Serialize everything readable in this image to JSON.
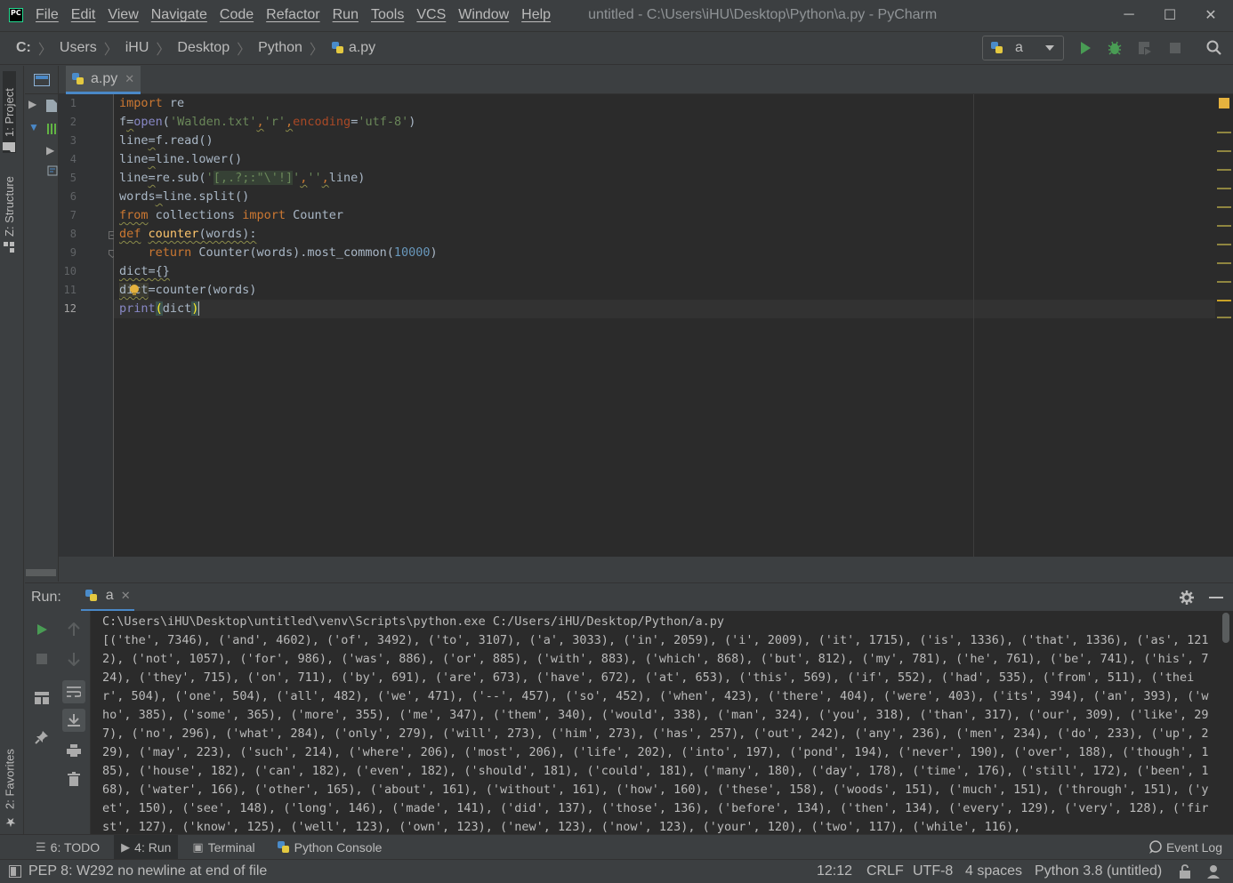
{
  "titlebar": {
    "menu": [
      "File",
      "Edit",
      "View",
      "Navigate",
      "Code",
      "Refactor",
      "Run",
      "Tools",
      "VCS",
      "Window",
      "Help"
    ],
    "window_title": "untitled - C:\\Users\\iHU\\Desktop\\Python\\a.py - PyCharm",
    "controls": {
      "minimize": "─",
      "maximize": "☐",
      "close": "✕"
    }
  },
  "navbar": {
    "crumbs": [
      "C:",
      "Users",
      "iHU",
      "Desktop",
      "Python",
      "a.py"
    ],
    "separator": "〉",
    "run_config": "a"
  },
  "toolbar_icons": [
    "run-icon",
    "debug-icon",
    "coverage-icon",
    "stop-icon",
    "search-icon"
  ],
  "left_stripe": {
    "project_tab": "1: Project",
    "structure_tab": "Z: Structure",
    "favorites_tab": "2: Favorites"
  },
  "editor": {
    "tab_label": "a.py",
    "tab_close": "✕",
    "line_numbers": [
      "1",
      "2",
      "3",
      "4",
      "5",
      "6",
      "7",
      "8",
      "9",
      "10",
      "11",
      "12"
    ],
    "code_lines": [
      "import re",
      "f=open('Walden.txt','r',encoding='utf-8')",
      "line=f.read()",
      "line=line.lower()",
      "line=re.sub('[,.?;:\"\\'!]','',line)",
      "words=line.split()",
      "from collections import Counter",
      "def counter(words):",
      "    return Counter(words).most_common(10000)",
      "dict={}",
      "dict=counter(words)",
      "print(dict)"
    ]
  },
  "run_window": {
    "title": "Run:",
    "tab_label": "a",
    "tab_close": "✕",
    "command": "C:\\Users\\iHU\\Desktop\\untitled\\venv\\Scripts\\python.exe C:/Users/iHU/Desktop/Python/a.py",
    "output": "[('the', 7346), ('and', 4602), ('of', 3492), ('to', 3107), ('a', 3033), ('in', 2059), ('i', 2009), ('it', 1715), ('is', 1336), ('that', 1336), ('as', 1212), ('not', 1057), ('for', 986), ('was', 886), ('or', 885), ('with', 883), ('which', 868), ('but', 812), ('my', 781), ('he', 761), ('be', 741), ('his', 724), ('they', 715), ('on', 711), ('by', 691), ('are', 673), ('have', 672), ('at', 653), ('this', 569), ('if', 552), ('had', 535), ('from', 511), ('their', 504), ('one', 504), ('all', 482), ('we', 471), ('--', 457), ('so', 452), ('when', 423), ('there', 404), ('were', 403), ('its', 394), ('an', 393), ('who', 385), ('some', 365), ('more', 355), ('me', 347), ('them', 340), ('would', 338), ('man', 324), ('you', 318), ('than', 317), ('our', 309), ('like', 297), ('no', 296), ('what', 284), ('only', 279), ('will', 273), ('him', 273), ('has', 257), ('out', 242), ('any', 236), ('men', 234), ('do', 233), ('up', 229), ('may', 223), ('such', 214), ('where', 206), ('most', 206), ('life', 202), ('into', 197), ('pond', 194), ('never', 190), ('over', 188), ('though', 185), ('house', 182), ('can', 182), ('even', 182), ('should', 181), ('could', 181), ('many', 180), ('day', 178), ('time', 176), ('still', 172), ('been', 168), ('water', 166), ('other', 165), ('about', 161), ('without', 161), ('how', 160), ('these', 158), ('woods', 151), ('much', 151), ('through', 151), ('yet', 150), ('see', 148), ('long', 146), ('made', 141), ('did', 137), ('those', 136), ('before', 134), ('then', 134), ('every', 129), ('very', 128), ('first', 127), ('know', 125), ('well', 123), ('own', 123), ('new', 123), ('now', 123), ('your', 120), ('two', 117), ('while', 116),"
  },
  "bottom_tabs": {
    "todo": "6: TODO",
    "run": "4: Run",
    "terminal": "Terminal",
    "python_console": "Python Console",
    "event_log": "Event Log"
  },
  "status_bar": {
    "message": "PEP 8: W292 no newline at end of file",
    "position": "12:12",
    "line_sep": "CRLF",
    "encoding": "UTF-8",
    "indent": "4 spaces",
    "interpreter": "Python 3.8 (untitled)"
  }
}
